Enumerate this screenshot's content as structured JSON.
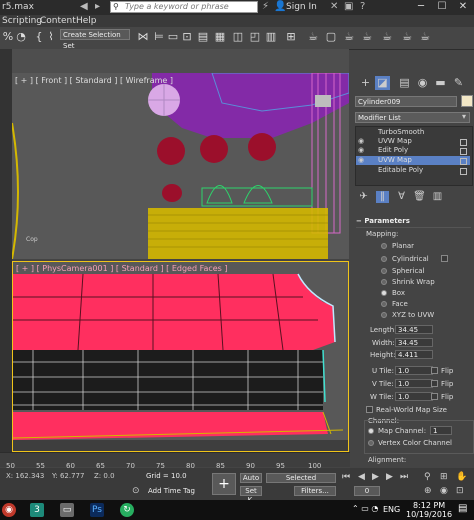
{
  "window": {
    "title": "r5.max",
    "search_placeholder": "Type a keyword or phrase",
    "sign_in": "Sign In"
  },
  "menu": [
    "Scripting",
    "Content",
    "Help"
  ],
  "toolbar": {
    "selection_set": "Create Selection Set"
  },
  "viewports": {
    "front_label": "[ + ] [ Front ] [ Standard ] [ Wireframe ]",
    "camera_label": "[ + ] [ PhysCamera001 ] [ Standard ] [ Edged Faces ]"
  },
  "command_panel": {
    "object_name": "Cylinder009",
    "object_color": "#f2e7c6",
    "modifier_list": "Modifier List",
    "stack": [
      {
        "label": "TurboSmooth",
        "selected": false
      },
      {
        "label": "UVW Map",
        "selected": false
      },
      {
        "label": "Edit Poly",
        "selected": false
      },
      {
        "label": "UVW Map",
        "selected": true
      },
      {
        "label": "Editable Poly",
        "selected": false
      }
    ],
    "parameters_title": "Parameters",
    "mapping_label": "Mapping:",
    "mapping_options": [
      {
        "label": "Planar",
        "on": false
      },
      {
        "label": "Cylindrical",
        "on": false
      },
      {
        "label": "Spherical",
        "on": false
      },
      {
        "label": "Shrink Wrap",
        "on": false
      },
      {
        "label": "Box",
        "on": true
      },
      {
        "label": "Face",
        "on": false
      },
      {
        "label": "XYZ to UVW",
        "on": false
      }
    ],
    "length_label": "Length:",
    "length_value": "34.45",
    "width_label": "Width:",
    "width_value": "34.45",
    "height_label": "Height:",
    "height_value": "4.411",
    "u_tile_label": "U Tile:",
    "u_tile_value": "1.0",
    "v_tile_label": "V Tile:",
    "v_tile_value": "1.0",
    "w_tile_label": "W Tile:",
    "w_tile_value": "1.0",
    "flip_label": "Flip",
    "real_world_label": "Real-World Map Size",
    "channel_label": "Channel:",
    "map_channel_label": "Map Channel:",
    "map_channel_value": "1",
    "vertex_color_label": "Vertex Color Channel",
    "alignment_label": "Alignment:"
  },
  "timeline": {
    "ticks": [
      "50",
      "55",
      "60",
      "65",
      "70",
      "75",
      "80",
      "85",
      "90",
      "95",
      "100"
    ]
  },
  "status": {
    "x_label": "X:",
    "x_value": "162.343",
    "y_label": "Y:",
    "y_value": "62.777",
    "z_label": "Z:",
    "z_value": "0.0",
    "grid_label": "Grid = 10.0",
    "add_time_tag": "Add Time Tag",
    "auto_label": "Auto",
    "selected_label": "Selected",
    "set_key_label": "Set K.",
    "filters_label": "Filters...",
    "frame_value": "0"
  },
  "taskbar": {
    "lang": "ENG",
    "time": "8:12 PM",
    "date": "10/19/2016"
  }
}
